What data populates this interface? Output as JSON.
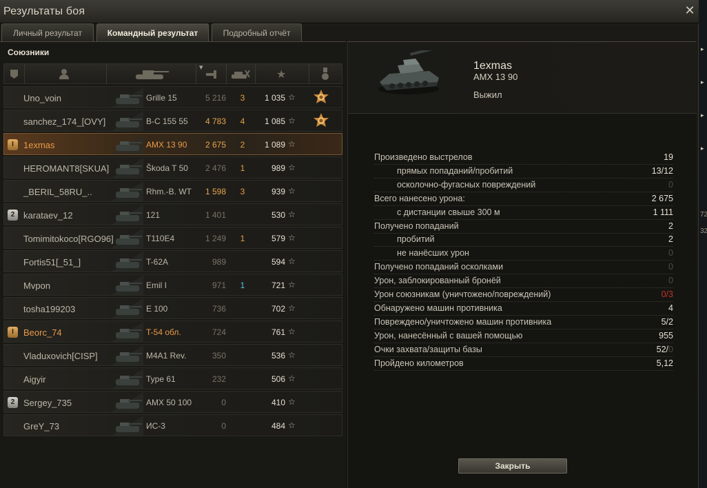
{
  "window": {
    "title": "Результаты боя",
    "close_glyph": "✕"
  },
  "tabs": [
    {
      "label": "Личный результат",
      "active": false
    },
    {
      "label": "Командный результат",
      "active": true
    },
    {
      "label": "Подробный отчёт",
      "active": false
    }
  ],
  "allies": {
    "title": "Союзники",
    "header_icons": [
      "platoon-icon",
      "player-icon",
      "vehicle-icon",
      "damage-icon",
      "kills-icon",
      "xp-star-icon",
      "medal-icon"
    ],
    "sort_indicator": "▾",
    "rows": [
      {
        "player": "Uno_voin",
        "vehicle": "Grille 15",
        "damage": "5 216",
        "kills": "3",
        "xp": "1 035",
        "badge": "",
        "medal": true,
        "mine": false,
        "orange": false,
        "damage_gold": false,
        "kills_blue": false
      },
      {
        "player": "sanchez_174_[OVY]",
        "vehicle": "B-C 155 55",
        "damage": "4 783",
        "kills": "4",
        "xp": "1 085",
        "badge": "",
        "medal": true,
        "mine": false,
        "orange": false,
        "damage_gold": true,
        "kills_blue": false
      },
      {
        "player": "1exmas",
        "vehicle": "AMX 13 90",
        "damage": "2 675",
        "kills": "2",
        "xp": "1 089",
        "badge": "I",
        "medal": false,
        "mine": true,
        "orange": true,
        "damage_gold": true,
        "kills_blue": false
      },
      {
        "player": "HEROMANT8[SKUA]",
        "vehicle": "Škoda T 50",
        "damage": "2 476",
        "kills": "1",
        "xp": "989",
        "badge": "",
        "medal": false,
        "mine": false,
        "orange": false,
        "damage_gold": false,
        "kills_blue": false
      },
      {
        "player": "_BERIL_58RU_..",
        "vehicle": "Rhm.-B. WT",
        "damage": "1 598",
        "kills": "3",
        "xp": "939",
        "badge": "",
        "medal": false,
        "mine": false,
        "orange": false,
        "damage_gold": true,
        "kills_blue": false
      },
      {
        "player": "karataev_12",
        "vehicle": "121",
        "damage": "1 401",
        "kills": "",
        "xp": "530",
        "badge": "2",
        "medal": false,
        "mine": false,
        "orange": false,
        "damage_gold": false,
        "kills_blue": false
      },
      {
        "player": "Tomimitokoco[RGO96]",
        "vehicle": "T110E4",
        "damage": "1 249",
        "kills": "1",
        "xp": "579",
        "badge": "",
        "medal": false,
        "mine": false,
        "orange": false,
        "damage_gold": false,
        "kills_blue": false
      },
      {
        "player": "Fortis51[_51_]",
        "vehicle": "T-62A",
        "damage": "989",
        "kills": "",
        "xp": "594",
        "badge": "",
        "medal": false,
        "mine": false,
        "orange": false,
        "damage_gold": false,
        "kills_blue": false
      },
      {
        "player": "Mvpon",
        "vehicle": "Emil I",
        "damage": "971",
        "kills": "1",
        "xp": "721",
        "badge": "",
        "medal": false,
        "mine": false,
        "orange": false,
        "damage_gold": false,
        "kills_blue": true
      },
      {
        "player": "tosha199203",
        "vehicle": "E 100",
        "damage": "736",
        "kills": "",
        "xp": "702",
        "badge": "",
        "medal": false,
        "mine": false,
        "orange": false,
        "damage_gold": false,
        "kills_blue": false
      },
      {
        "player": "Beorc_74",
        "vehicle": "T-54 обл.",
        "damage": "724",
        "kills": "",
        "xp": "761",
        "badge": "I",
        "medal": false,
        "mine": false,
        "orange": true,
        "damage_gold": false,
        "kills_blue": false
      },
      {
        "player": "Vladuxovich[CISP]",
        "vehicle": "M4A1 Rev.",
        "damage": "350",
        "kills": "",
        "xp": "536",
        "badge": "",
        "medal": false,
        "mine": false,
        "orange": false,
        "damage_gold": false,
        "kills_blue": false
      },
      {
        "player": "Aigyir",
        "vehicle": "Type 61",
        "damage": "232",
        "kills": "",
        "xp": "506",
        "badge": "",
        "medal": false,
        "mine": false,
        "orange": false,
        "damage_gold": false,
        "kills_blue": false
      },
      {
        "player": "Sergey_735",
        "vehicle": "AMX 50 100",
        "damage": "0",
        "kills": "",
        "xp": "410",
        "badge": "2",
        "medal": false,
        "mine": false,
        "orange": false,
        "damage_gold": false,
        "kills_blue": false
      },
      {
        "player": "GreY_73",
        "vehicle": "ИС-3",
        "damage": "0",
        "kills": "",
        "xp": "484",
        "badge": "",
        "medal": false,
        "mine": false,
        "orange": false,
        "damage_gold": false,
        "kills_blue": false
      }
    ]
  },
  "detail": {
    "player": "1exmas",
    "vehicle": "AMX 13 90",
    "status": "Выжил",
    "stats": [
      {
        "label": "Произведено выстрелов",
        "value": "19",
        "indent": false,
        "style": ""
      },
      {
        "label": "прямых попаданий/пробитий",
        "value": "13/12",
        "indent": true,
        "style": ""
      },
      {
        "label": "осколочно-фугасных повреждений",
        "value": "0",
        "indent": true,
        "style": "dim"
      },
      {
        "label": "Всего нанесено урона:",
        "value": "2 675",
        "indent": false,
        "style": ""
      },
      {
        "label": "с дистанции свыше 300 м",
        "value": "1 111",
        "indent": true,
        "style": ""
      },
      {
        "label": "Получено попаданий",
        "value": "2",
        "indent": false,
        "style": ""
      },
      {
        "label": "пробитий",
        "value": "2",
        "indent": true,
        "style": ""
      },
      {
        "label": "не нанёсших урон",
        "value": "0",
        "indent": true,
        "style": "dim"
      },
      {
        "label": "Получено попаданий осколками",
        "value": "0",
        "indent": false,
        "style": "dim"
      },
      {
        "label": "Урон, заблокированный бронёй",
        "value": "0",
        "indent": false,
        "style": "dim"
      },
      {
        "label": "Урон союзникам (уничтожено/повреждений)",
        "value": "0/3",
        "indent": false,
        "style": "red"
      },
      {
        "label": "Обнаружено машин противника",
        "value": "4",
        "indent": false,
        "style": ""
      },
      {
        "label": "Повреждено/уничтожено машин противника",
        "value": "5/2",
        "indent": false,
        "style": ""
      },
      {
        "label": "Урон, нанесённый с вашей помощью",
        "value": "955",
        "indent": false,
        "style": ""
      },
      {
        "label": "Очки захвата/защиты базы",
        "value": "52/",
        "value_dim": "0",
        "indent": false,
        "style": "split"
      },
      {
        "label": "Пройдено километров",
        "value": "5,12",
        "indent": false,
        "style": ""
      }
    ],
    "close_button": "Закрыть"
  },
  "side_strip": {
    "numbers": [
      "72",
      "32"
    ]
  },
  "colors": {
    "accent_orange": "#e89a4a",
    "gold": "#e7a64f",
    "blue": "#52c3e6",
    "red": "#c0342c"
  }
}
